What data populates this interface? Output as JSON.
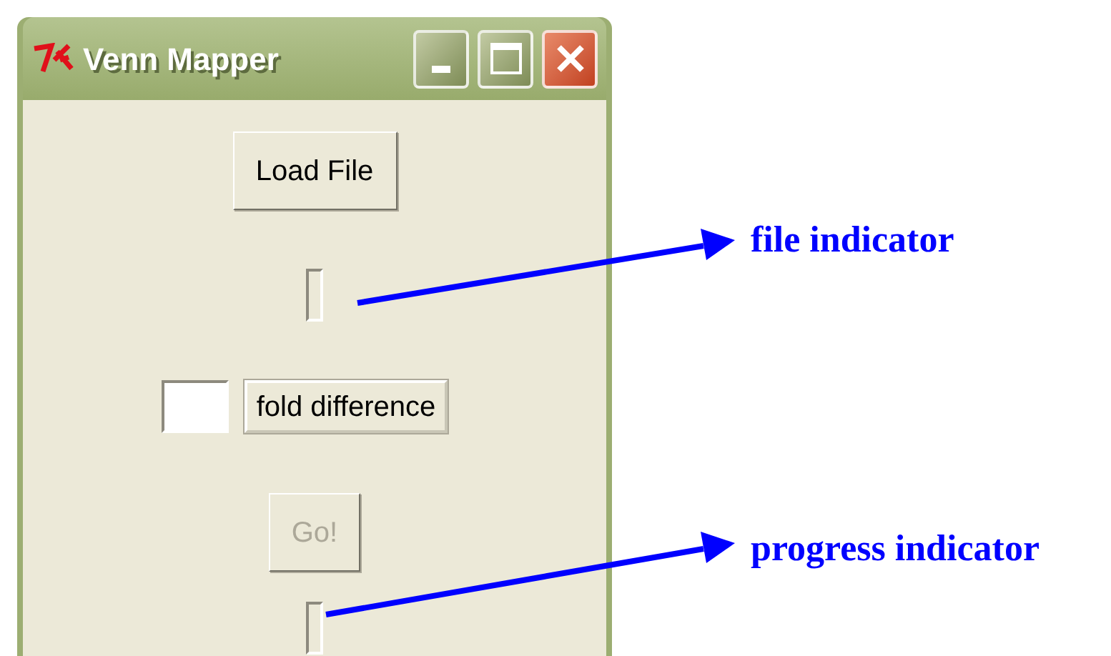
{
  "window": {
    "title": "Venn Mapper"
  },
  "load_button": {
    "label": "Load File",
    "disabled": false
  },
  "fold_label": "fold difference",
  "go_button": {
    "label": "Go!",
    "disabled": true
  },
  "annotations": [
    {
      "text": "file indicator"
    },
    {
      "text": "progress indicator"
    }
  ]
}
